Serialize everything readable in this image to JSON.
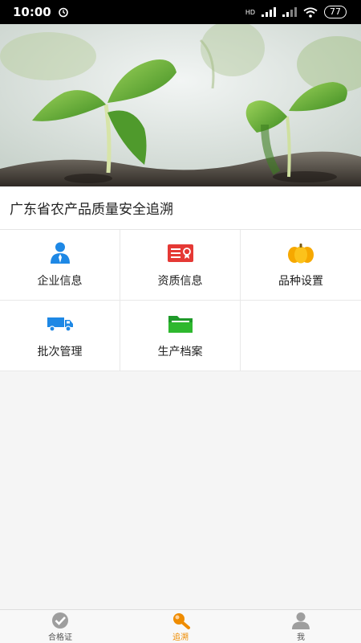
{
  "status_bar": {
    "time": "10:00",
    "network": "HD",
    "battery": "77"
  },
  "app_title": "广东省农产品质量安全追溯",
  "menu": [
    {
      "label": "企业信息",
      "icon": "person-icon",
      "color": "#1e88e5"
    },
    {
      "label": "资质信息",
      "icon": "certificate-icon",
      "color": "#e53935"
    },
    {
      "label": "品种设置",
      "icon": "pumpkin-icon",
      "color": "#fbb617"
    },
    {
      "label": "批次管理",
      "icon": "truck-icon",
      "color": "#1e88e5"
    },
    {
      "label": "生产档案",
      "icon": "folder-icon",
      "color": "#2eb82e"
    }
  ],
  "tabs": [
    {
      "label": "合格证",
      "icon": "check-badge-icon",
      "active": false
    },
    {
      "label": "追溯",
      "icon": "magnifier-icon",
      "active": true
    },
    {
      "label": "我",
      "icon": "profile-icon",
      "active": false
    }
  ],
  "colors": {
    "accent": "#ef8c00",
    "status_bar_bg": "#000000",
    "page_bg": "#f5f5f5"
  }
}
